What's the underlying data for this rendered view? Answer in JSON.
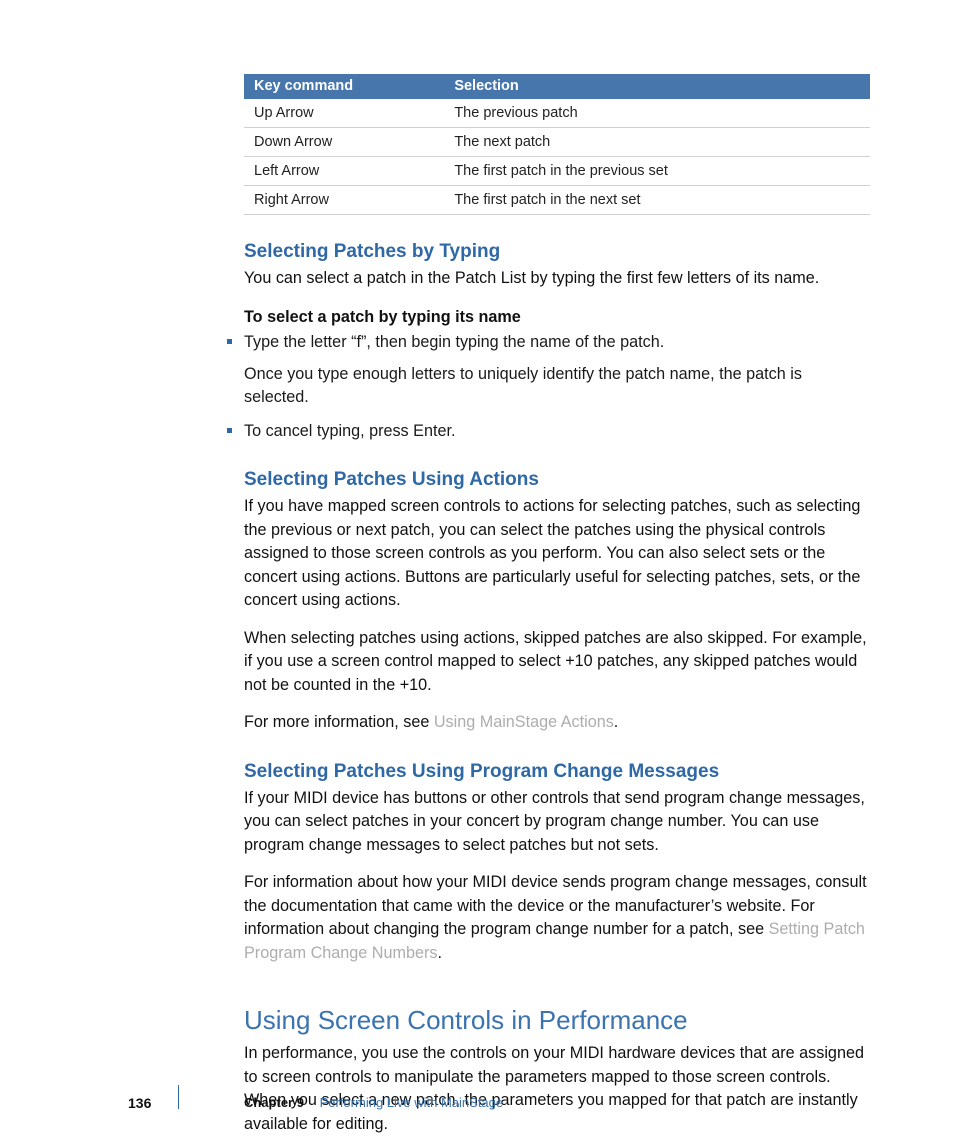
{
  "table": {
    "headers": [
      "Key command",
      "Selection"
    ],
    "rows": [
      [
        "Up Arrow",
        "The previous patch"
      ],
      [
        "Down Arrow",
        "The next patch"
      ],
      [
        "Left Arrow",
        "The first patch in the previous set"
      ],
      [
        "Right Arrow",
        "The first patch in the next set"
      ]
    ]
  },
  "s1": {
    "heading": "Selecting Patches by Typing",
    "p1": "You can select a patch in the Patch List by typing the first few letters of its name.",
    "lead": "To select a patch by typing its name",
    "b1": "Type the letter “f”, then begin typing the name of the patch.",
    "b1_sub": "Once you type enough letters to uniquely identify the patch name, the patch is selected.",
    "b2": "To cancel typing, press Enter."
  },
  "s2": {
    "heading": "Selecting Patches Using Actions",
    "p1": "If you have mapped screen controls to actions for selecting patches, such as selecting the previous or next patch, you can select the patches using the physical controls assigned to those screen controls as you perform. You can also select sets or the concert using actions. Buttons are particularly useful for selecting patches, sets, or the concert using actions.",
    "p2": "When selecting patches using actions, skipped patches are also skipped. For example, if you use a screen control mapped to select +10 patches, any skipped patches would not be counted in the +10.",
    "p3_pre": "For more information, see ",
    "p3_link": "Using MainStage Actions",
    "p3_post": "."
  },
  "s3": {
    "heading": "Selecting Patches Using Program Change Messages",
    "p1": "If your MIDI device has buttons or other controls that send program change messages, you can select patches in your concert by program change number. You can use program change messages to select patches but not sets.",
    "p2_pre": "For information about how your MIDI device sends program change messages, consult the documentation that came with the device or the manufacturer’s website. For information about changing the program change number for a patch, see ",
    "p2_link": "Setting Patch Program Change Numbers",
    "p2_post": "."
  },
  "s4": {
    "heading": "Using Screen Controls in Performance",
    "p1": "In performance, you use the controls on your MIDI hardware devices that are assigned to screen controls to manipulate the parameters mapped to those screen controls. When you select a new patch, the parameters you mapped for that patch are instantly available for editing."
  },
  "footer": {
    "page": "136",
    "chapter_label": "Chapter 9",
    "chapter_title": "Performing Live with MainStage"
  }
}
